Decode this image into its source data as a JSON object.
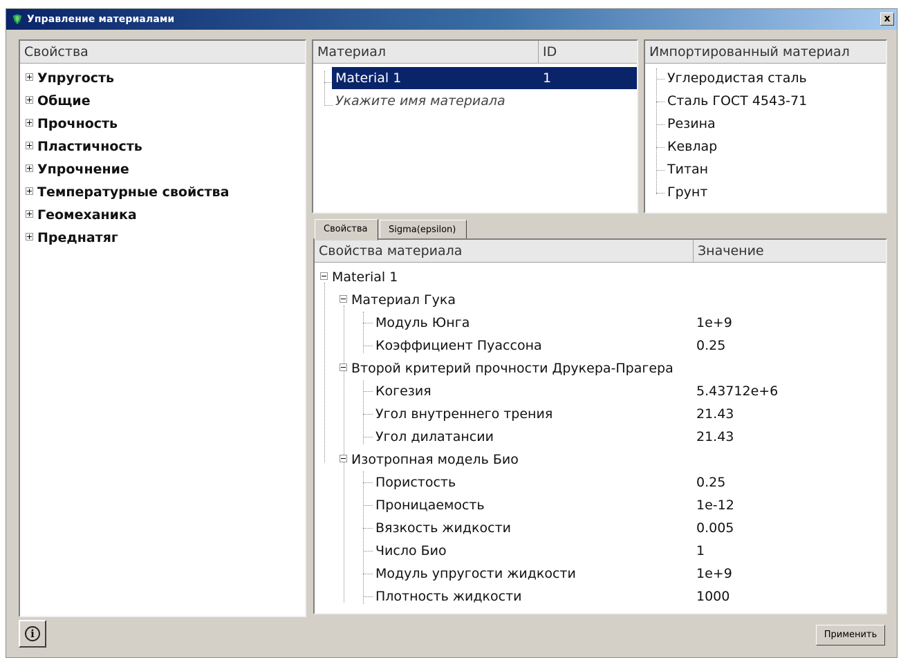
{
  "window": {
    "title": "Управление материалами",
    "close_label": "x"
  },
  "properties_panel": {
    "header": "Свойства",
    "items": [
      {
        "label": "Упругость"
      },
      {
        "label": "Общие"
      },
      {
        "label": "Прочность"
      },
      {
        "label": "Пластичность"
      },
      {
        "label": "Упрочнение"
      },
      {
        "label": "Температурные свойства"
      },
      {
        "label": "Геомеханика"
      },
      {
        "label": "Преднатяг"
      }
    ]
  },
  "materials_panel": {
    "header_material": "Материал",
    "header_id": "ID",
    "rows": [
      {
        "name": "Material 1",
        "id": "1"
      }
    ],
    "placeholder_row": "Укажите имя материала"
  },
  "imported_panel": {
    "header": "Импортированный материал",
    "items": [
      {
        "label": "Углеродистая сталь"
      },
      {
        "label": "Сталь ГОСТ 4543-71"
      },
      {
        "label": "Резина"
      },
      {
        "label": "Кевлар"
      },
      {
        "label": "Титан"
      },
      {
        "label": "Грунт"
      }
    ]
  },
  "tabs": [
    {
      "label": "Свойства"
    },
    {
      "label": "Sigma(epsilon)"
    }
  ],
  "props_table": {
    "header_name": "Свойства материала",
    "header_value": "Значение",
    "root": "Material 1",
    "groups": [
      {
        "label": "Материал Гука",
        "rows": [
          {
            "label": "Модуль Юнга",
            "value": "1e+9"
          },
          {
            "label": "Коэффициент Пуассона",
            "value": "0.25"
          }
        ]
      },
      {
        "label": "Второй критерий прочности Друкера-Прагера",
        "rows": [
          {
            "label": "Когезия",
            "value": "5.43712e+6"
          },
          {
            "label": "Угол внутреннего трения",
            "value": "21.43"
          },
          {
            "label": "Угол дилатансии",
            "value": "21.43"
          }
        ]
      },
      {
        "label": "Изотропная модель Био",
        "rows": [
          {
            "label": "Пористость",
            "value": "0.25"
          },
          {
            "label": "Проницаемость",
            "value": "1e-12"
          },
          {
            "label": "Вязкость жидкости",
            "value": "0.005"
          },
          {
            "label": "Число Био",
            "value": "1"
          },
          {
            "label": "Модуль упругости жидкости",
            "value": "1e+9"
          },
          {
            "label": "Плотность жидкости",
            "value": "1000"
          }
        ]
      }
    ]
  },
  "footer": {
    "info_symbol": "i",
    "apply_label": "Применить"
  },
  "colors": {
    "selection": "#0a246a",
    "window_bg": "#d4d0c8"
  }
}
